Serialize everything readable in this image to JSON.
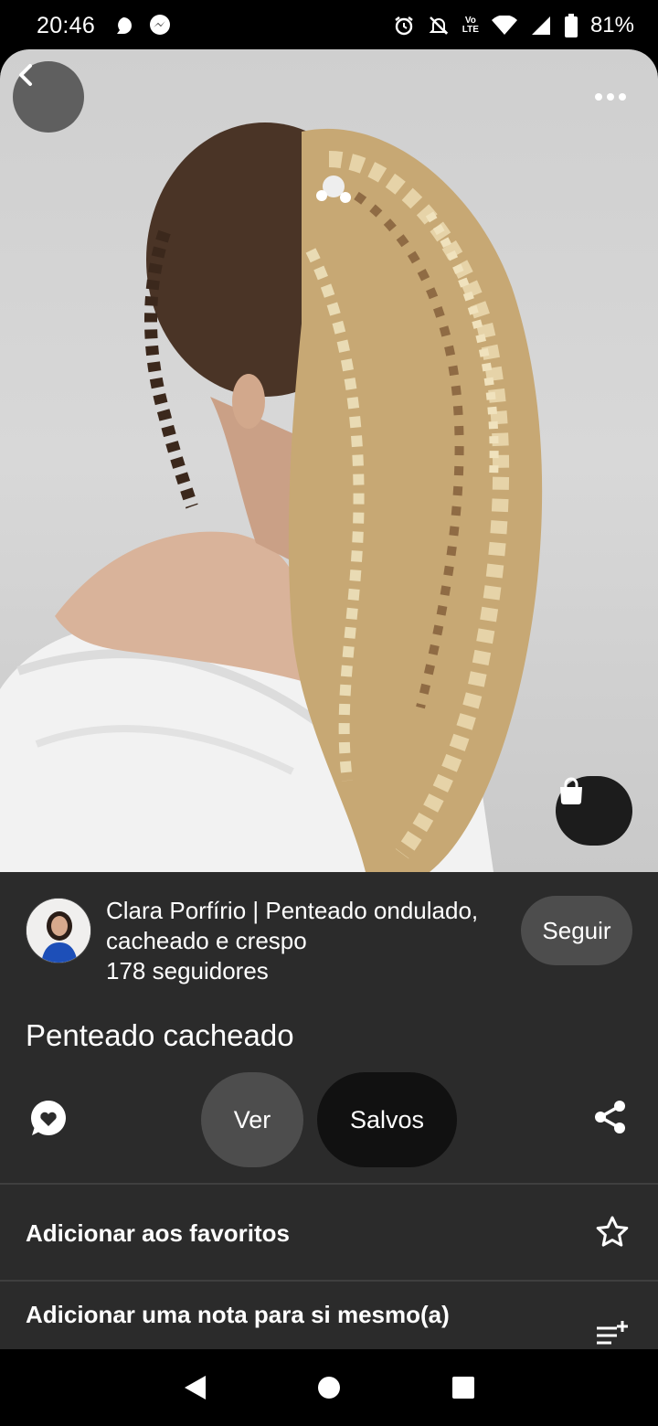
{
  "status_bar": {
    "time": "20:46",
    "left_icons": [
      "chat-bubble-icon",
      "messenger-icon"
    ],
    "right_icons": [
      "alarm-icon",
      "notifications-off-icon",
      "volte-icon",
      "wifi-icon",
      "cell-signal-icon",
      "battery-icon"
    ],
    "volte_label_top": "Vo",
    "volte_label_bottom": "LTE",
    "battery_percent": "81%"
  },
  "pin": {
    "image_icons": {
      "back": "back-arrow-icon",
      "more": "more-options-icon",
      "shop": "shopping-bag-icon"
    }
  },
  "creator": {
    "name": "Clara Porfírio | Penteado ondulado, cacheado e crespo",
    "followers": "178 seguidores",
    "follow_label": "Seguir"
  },
  "title": "Penteado cacheado",
  "actions": {
    "ver_label": "Ver",
    "salvos_label": "Salvos",
    "comment_icon": "comment-heart-icon",
    "share_icon": "share-icon"
  },
  "options": [
    {
      "label": "Adicionar aos favoritos",
      "icon": "star-outline-icon"
    },
    {
      "label": "Adicionar uma nota para si mesmo(a)",
      "icon": "add-note-icon"
    }
  ],
  "nav_bar": {
    "icons": [
      "nav-back-icon",
      "nav-home-icon",
      "nav-recents-icon"
    ]
  },
  "colors": {
    "panel_bg": "#2b2b2b",
    "button_gray": "#4d4d4d",
    "button_black": "#111111",
    "text": "#ffffff"
  }
}
